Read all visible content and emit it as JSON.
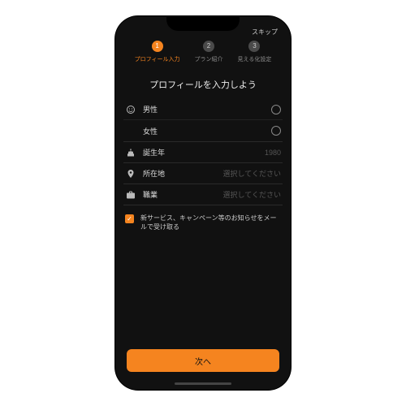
{
  "skip": "スキップ",
  "steps": [
    {
      "num": "1",
      "label": "プロフィール入力",
      "active": true
    },
    {
      "num": "2",
      "label": "プラン紹介",
      "active": false
    },
    {
      "num": "3",
      "label": "見える化設定",
      "active": false
    }
  ],
  "title": "プロフィールを入力しよう",
  "gender": {
    "male": "男性",
    "female": "女性"
  },
  "birth_year": {
    "label": "誕生年",
    "value": "1980"
  },
  "location": {
    "label": "所在地",
    "placeholder": "選択してください"
  },
  "occupation": {
    "label": "職業",
    "placeholder": "選択してください"
  },
  "newsletter": "新サービス、キャンペーン等のお知らせをメールで受け取る",
  "next": "次へ"
}
